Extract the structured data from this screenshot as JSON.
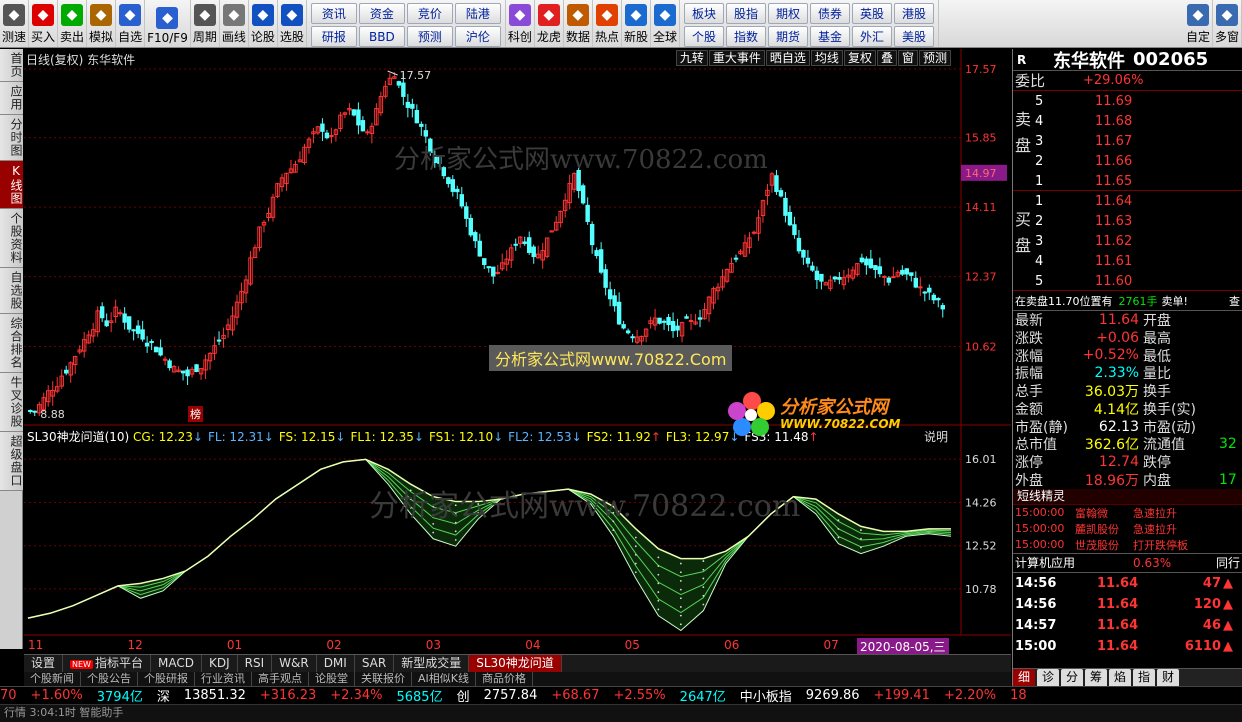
{
  "toolbar": {
    "left_buttons": [
      {
        "label": "测速",
        "icon": "speed-test-icon"
      },
      {
        "label": "买入",
        "icon": "buy-icon"
      },
      {
        "label": "卖出",
        "icon": "sell-icon"
      },
      {
        "label": "模拟",
        "icon": "simulate-icon"
      },
      {
        "label": "自选",
        "icon": "watchlist-icon"
      },
      {
        "label": "F10/F9",
        "icon": "f10-icon"
      },
      {
        "label": "周期",
        "icon": "period-icon"
      },
      {
        "label": "画线",
        "icon": "draw-line-icon"
      },
      {
        "label": "论股",
        "icon": "discuss-icon"
      },
      {
        "label": "选股",
        "icon": "stock-picker-icon"
      }
    ],
    "grid1": [
      "资讯",
      "资金",
      "竞价",
      "陆港",
      "研报",
      "BBD",
      "预测",
      "沪伦"
    ],
    "mid_buttons": [
      {
        "label": "科创",
        "icon": "star-market-icon"
      },
      {
        "label": "龙虎",
        "icon": "dragon-tiger-icon"
      },
      {
        "label": "数据",
        "icon": "data-icon"
      },
      {
        "label": "热点",
        "icon": "hotspot-icon"
      },
      {
        "label": "新股",
        "icon": "ipo-icon"
      },
      {
        "label": "全球",
        "icon": "globe-icon"
      }
    ],
    "grid2": [
      "板块",
      "股指",
      "期权",
      "债券",
      "英股",
      "港股",
      "个股",
      "指数",
      "期货",
      "基金",
      "外汇",
      "美股"
    ],
    "right_buttons": [
      {
        "label": "自定",
        "icon": "customize-icon"
      },
      {
        "label": "多窗",
        "icon": "multi-window-icon"
      }
    ]
  },
  "left_tabs": [
    {
      "label": "首页",
      "active": false
    },
    {
      "label": "应用",
      "active": false
    },
    {
      "label": "分时图",
      "active": false
    },
    {
      "label": "K线图",
      "active": true
    },
    {
      "label": "个股资料",
      "active": false
    },
    {
      "label": "自选股",
      "active": false
    },
    {
      "label": "综合排名",
      "active": false
    },
    {
      "label": "牛叉诊股",
      "active": false
    },
    {
      "label": "超级盘口",
      "active": false
    }
  ],
  "chart": {
    "header": "日线(复权) 东华软件",
    "top_tools": [
      "九转",
      "重大事件",
      "晒自选",
      "均线",
      "复权",
      "叠",
      "窗",
      "预测"
    ],
    "watermarks": [
      "分析家公式网www.70822.com",
      "分析家公式网www.70822.Com",
      "分析家公式网www.70822.com"
    ],
    "logo_text": "分析家公式网",
    "logo_url": "WWW.70822.COM",
    "marker_label": "榜",
    "explain_label": "说明",
    "date_badge": "2020-08-05,三",
    "indicator": {
      "name": "SL30神龙问道(10)",
      "items": [
        {
          "key": "CG",
          "value": "12.23",
          "arrow": "↓",
          "color": "#ffff00"
        },
        {
          "key": "FL",
          "value": "12.31",
          "arrow": "↓",
          "color": "#5ab4ff"
        },
        {
          "key": "FS",
          "value": "12.15",
          "arrow": "↓",
          "color": "#ffff00"
        },
        {
          "key": "FL1",
          "value": "12.35",
          "arrow": "↓",
          "color": "#ffff00"
        },
        {
          "key": "FS1",
          "value": "12.10",
          "arrow": "↓",
          "color": "#ffff00"
        },
        {
          "key": "FL2",
          "value": "12.53",
          "arrow": "↓",
          "color": "#5ab4ff"
        },
        {
          "key": "FS2",
          "value": "11.92",
          "arrow": "↑",
          "color": "#ffff00"
        },
        {
          "key": "FL3",
          "value": "12.97",
          "arrow": "↓",
          "color": "#ffff00"
        },
        {
          "key": "FS3",
          "value": "11.48",
          "arrow": "↑",
          "color": "#ffffff"
        }
      ]
    }
  },
  "chart_data": [
    {
      "type": "candlestick",
      "title": "日线(复权) 东华软件",
      "ylim": [
        8.88,
        17.57
      ],
      "y_ticks": [
        17.57,
        15.85,
        14.11,
        12.37,
        10.62
      ],
      "current_price_tag": 14.97,
      "max_label": "17.57",
      "min_label": "8.88",
      "x_month_labels": [
        "11",
        "12",
        "01",
        "02",
        "03",
        "04",
        "05",
        "06",
        "07",
        "08"
      ],
      "close_path": [
        9.0,
        9.3,
        9.6,
        9.9,
        10.2,
        10.6,
        11.0,
        11.4,
        11.2,
        11.5,
        11.3,
        11.0,
        10.9,
        10.7,
        10.4,
        10.2,
        10.0,
        9.9,
        10.1,
        10.3,
        10.6,
        10.9,
        11.4,
        12.0,
        12.8,
        13.5,
        14.0,
        14.6,
        15.0,
        15.2,
        15.6,
        15.9,
        16.1,
        15.8,
        16.3,
        16.5,
        16.2,
        15.9,
        16.5,
        17.2,
        17.5,
        16.9,
        16.5,
        16.1,
        15.6,
        15.2,
        14.8,
        14.4,
        13.8,
        13.2,
        12.7,
        12.4,
        12.6,
        13.0,
        13.4,
        13.1,
        12.9,
        13.3,
        13.8,
        14.4,
        14.9,
        14.1,
        13.2,
        12.4,
        11.8,
        11.3,
        11.0,
        10.9,
        11.1,
        11.3,
        11.2,
        11.0,
        11.1,
        11.2,
        11.4,
        11.8,
        12.2,
        12.6,
        12.9,
        13.1,
        13.5,
        14.2,
        14.9,
        14.3,
        13.6,
        13.0,
        12.6,
        12.3,
        12.1,
        12.2,
        12.4,
        12.6,
        12.8,
        12.6,
        12.4,
        12.3,
        12.5,
        12.4,
        12.2,
        12.0,
        11.8,
        11.6
      ],
      "annotation": "SL30神龙问道 indicator ribbons"
    },
    {
      "type": "line",
      "title": "SL30神龙问道(10)",
      "ylim": [
        10.78,
        16.01
      ],
      "y_ticks": [
        16.01,
        14.26,
        12.52,
        10.78
      ],
      "series": [
        {
          "name": "CG",
          "values": [
            9.6,
            9.8,
            10.1,
            10.5,
            10.9,
            11.0,
            11.2,
            11.5,
            12.1,
            12.9,
            13.6,
            14.4,
            15.0,
            15.6,
            15.9,
            16.0,
            15.6,
            15.0,
            14.5,
            14.3,
            14.3,
            14.4,
            14.6,
            14.7,
            14.8,
            14.6,
            14.1,
            13.2,
            12.4,
            12.0,
            12.0,
            12.3,
            12.9,
            13.8,
            14.5,
            14.4,
            13.8,
            13.3,
            13.1,
            13.1,
            13.2,
            13.2
          ]
        },
        {
          "name": "FS3",
          "values": [
            9.6,
            9.8,
            10.1,
            10.5,
            10.9,
            10.4,
            10.7,
            11.5,
            12.1,
            12.9,
            13.6,
            14.4,
            15.0,
            15.6,
            15.9,
            16.0,
            15.0,
            13.8,
            12.8,
            12.5,
            13.6,
            14.4,
            14.6,
            14.7,
            14.8,
            14.2,
            12.9,
            11.2,
            9.7,
            9.1,
            9.9,
            11.8,
            12.9,
            13.8,
            14.5,
            13.8,
            12.6,
            12.2,
            12.5,
            12.9,
            13.0,
            12.9
          ]
        }
      ]
    }
  ],
  "stock": {
    "code_prefix": "R",
    "name": "东华软件",
    "code": "002065",
    "weibi_label": "委比",
    "weibi_value": "+29.06%",
    "sell_label": "卖盘",
    "buy_label": "买盘",
    "sell": [
      {
        "level": "5",
        "price": "11.69"
      },
      {
        "level": "4",
        "price": "11.68"
      },
      {
        "level": "3",
        "price": "11.67"
      },
      {
        "level": "2",
        "price": "11.66"
      },
      {
        "level": "1",
        "price": "11.65"
      }
    ],
    "buy": [
      {
        "level": "1",
        "price": "11.64"
      },
      {
        "level": "2",
        "price": "11.63"
      },
      {
        "level": "3",
        "price": "11.62"
      },
      {
        "level": "4",
        "price": "11.61"
      },
      {
        "level": "5",
        "price": "11.60"
      }
    ],
    "sell_note": {
      "text": "在卖盘11.70位置有",
      "qty": "2761手",
      "tail": "卖单!",
      "btn": "查"
    },
    "quotes": [
      {
        "l": "最新",
        "v": "11.64",
        "vc": "red",
        "r": "开盘",
        "rv": ""
      },
      {
        "l": "涨跌",
        "v": "+0.06",
        "vc": "red",
        "r": "最高",
        "rv": ""
      },
      {
        "l": "涨幅",
        "v": "+0.52%",
        "vc": "red",
        "r": "最低",
        "rv": ""
      },
      {
        "l": "振幅",
        "v": "2.33%",
        "vc": "cyn",
        "r": "量比",
        "rv": ""
      },
      {
        "l": "总手",
        "v": "36.03万",
        "vc": "yel",
        "r": "换手",
        "rv": ""
      },
      {
        "l": "金额",
        "v": "4.14亿",
        "vc": "yel",
        "r": "换手(实)",
        "rv": ""
      },
      {
        "l": "市盈(静)",
        "v": "62.13",
        "vc": "wht",
        "r": "市盈(动)",
        "rv": ""
      },
      {
        "l": "总市值",
        "v": "362.6亿",
        "vc": "yel",
        "r": "流通值",
        "rv": "32"
      },
      {
        "l": "涨停",
        "v": "12.74",
        "vc": "red",
        "r": "跌停",
        "rv": ""
      },
      {
        "l": "外盘",
        "v": "18.96万",
        "vc": "red",
        "r": "内盘",
        "rv": "17"
      }
    ],
    "short_title": "短线精灵",
    "short_list": [
      {
        "time": "15:00:00",
        "name": "富翰微",
        "event": "急速拉升"
      },
      {
        "time": "15:00:00",
        "name": "麓凯股份",
        "event": "急速拉升"
      },
      {
        "time": "15:00:00",
        "name": "世茂股份",
        "event": "打开跌停板"
      }
    ],
    "sector": {
      "name": "计算机应用",
      "pct": "0.63%",
      "tail": "同行"
    },
    "ticks": [
      {
        "time": "14:56",
        "price": "11.64",
        "vol": "47",
        "dir": "up"
      },
      {
        "time": "14:56",
        "price": "11.64",
        "vol": "120",
        "dir": "up"
      },
      {
        "time": "14:57",
        "price": "11.64",
        "vol": "46",
        "dir": "up"
      },
      {
        "time": "15:00",
        "price": "11.64",
        "vol": "6110",
        "dir": "up"
      }
    ],
    "bottom_tabs": [
      "细",
      "诊",
      "分",
      "筹",
      "焰",
      "指",
      "财"
    ]
  },
  "index_tabs": [
    {
      "label": "设置",
      "new": false,
      "active": false
    },
    {
      "label": "指标平台",
      "new": true,
      "active": false
    },
    {
      "label": "MACD",
      "new": false,
      "active": false
    },
    {
      "label": "KDJ",
      "new": false,
      "active": false
    },
    {
      "label": "RSI",
      "new": false,
      "active": false
    },
    {
      "label": "W&R",
      "new": false,
      "active": false
    },
    {
      "label": "DMI",
      "new": false,
      "active": false
    },
    {
      "label": "SAR",
      "new": false,
      "active": false
    },
    {
      "label": "新型成交量",
      "new": false,
      "active": false
    },
    {
      "label": "SL30神龙问道",
      "new": false,
      "active": true
    }
  ],
  "new_badge": "NEW",
  "sub_tabs": [
    "个股新闻",
    "个股公告",
    "个股研报",
    "行业资讯",
    "高手观点",
    "论股堂",
    "关联报价",
    "AI相似K线",
    "商品价格"
  ],
  "status": [
    {
      "text": "70",
      "c": "red"
    },
    {
      "text": "+1.60%",
      "c": "red"
    },
    {
      "text": "3794亿",
      "c": "cyn"
    },
    {
      "text": "深",
      "c": "wht"
    },
    {
      "text": "13851.32",
      "c": "wht"
    },
    {
      "text": "+316.23",
      "c": "red"
    },
    {
      "text": "+2.34%",
      "c": "red"
    },
    {
      "text": "5685亿",
      "c": "cyn"
    },
    {
      "text": "创",
      "c": "wht"
    },
    {
      "text": "2757.84",
      "c": "wht"
    },
    {
      "text": "+68.67",
      "c": "red"
    },
    {
      "text": "+2.55%",
      "c": "red"
    },
    {
      "text": "2647亿",
      "c": "cyn"
    },
    {
      "text": "中小板指",
      "c": "wht"
    },
    {
      "text": "9269.86",
      "c": "wht"
    },
    {
      "text": "+199.41",
      "c": "red"
    },
    {
      "text": "+2.20%",
      "c": "red"
    },
    {
      "text": "18",
      "c": "red"
    }
  ],
  "status2": "行情  3:04:1时  智能助手"
}
